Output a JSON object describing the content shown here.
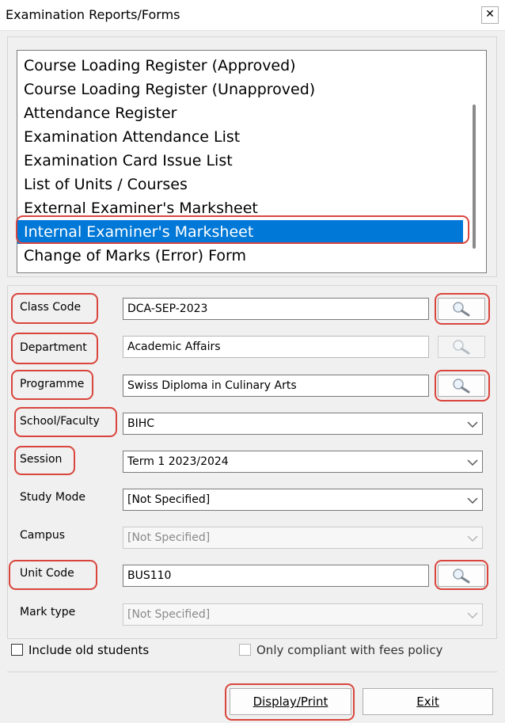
{
  "window": {
    "title": "Examination Reports/Forms",
    "close_glyph": "✕"
  },
  "report_list": {
    "items": [
      "Course Loading Register (Approved)",
      "Course Loading Register (Unapproved)",
      "Attendance Register",
      "Examination Attendance List",
      "Examination Card Issue List",
      "List of Units / Courses",
      "External Examiner's Marksheet",
      "Internal Examiner's Marksheet",
      "Change of Marks (Error) Form"
    ],
    "selected_index": 7
  },
  "form": {
    "class_code": {
      "label": "Class Code",
      "value": "DCA-SEP-2023"
    },
    "department": {
      "label": "Department",
      "value": "Academic Affairs"
    },
    "programme": {
      "label": "Programme",
      "value": "Swiss Diploma in Culinary Arts"
    },
    "school_faculty": {
      "label": "School/Faculty",
      "value": "BIHC"
    },
    "session": {
      "label": "Session",
      "value": "Term 1 2023/2024"
    },
    "study_mode": {
      "label": "Study Mode",
      "value": "[Not Specified]"
    },
    "campus": {
      "label": "Campus",
      "value": "[Not Specified]"
    },
    "unit_code": {
      "label": "Unit Code",
      "value": "BUS110"
    },
    "mark_type": {
      "label": "Mark type",
      "value": "[Not Specified]"
    }
  },
  "options": {
    "include_old_students": "Include old students",
    "only_compliant": "Only compliant with fees policy"
  },
  "buttons": {
    "display_print": "Display/Print",
    "exit": "Exit"
  },
  "colors": {
    "selection": "#0078d7",
    "highlight": "#d9453d"
  }
}
